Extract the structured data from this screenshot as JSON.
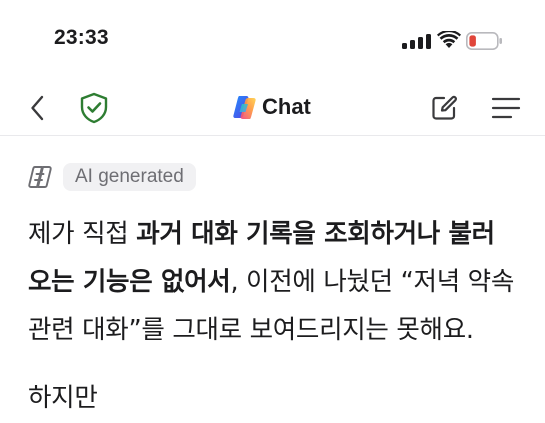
{
  "status_bar": {
    "time": "23:33",
    "icons": [
      "signal-icon",
      "wifi-icon",
      "battery-low-icon"
    ],
    "battery_color": "#e0453a"
  },
  "nav": {
    "title": "Chat",
    "icons": [
      "back-chevron-icon",
      "shield-check-icon",
      "copilot-logo-icon",
      "compose-icon",
      "menu-icon"
    ],
    "shield_color": "#2e7d32"
  },
  "label": {
    "ai_generated": "AI generated",
    "icon": "copilot-outline-icon"
  },
  "message": {
    "seg1": "제가 직접 ",
    "seg2_bold": "과거 대화 기록을 조회하거나 불러오는 기능은 없어서",
    "seg3": ", 이전에 나눴던 “저녁 약속 관련 대화”를 그대로 보여드리지는 못해요.",
    "next": "하지만"
  }
}
